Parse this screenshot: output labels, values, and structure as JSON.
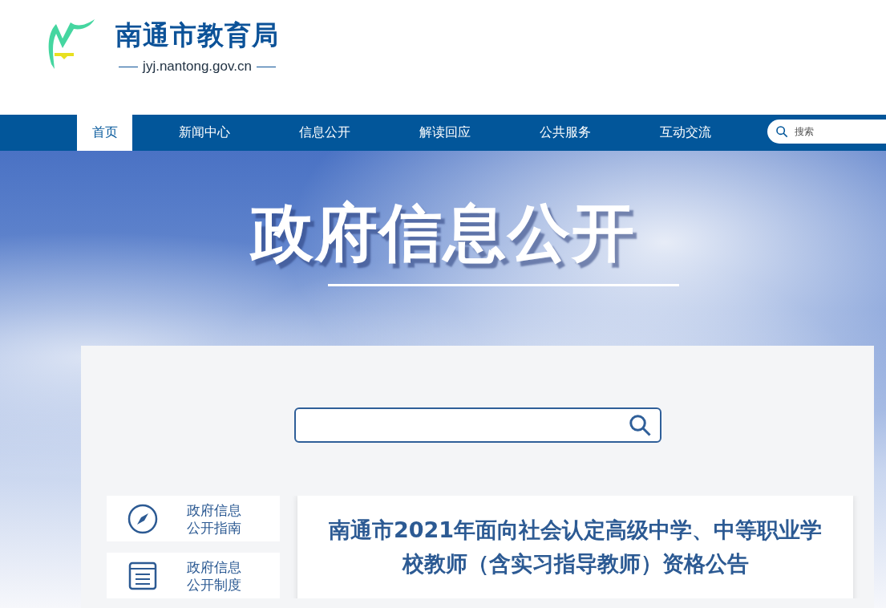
{
  "site": {
    "name": "南通市教育局",
    "domain": "jyj.nantong.gov.cn"
  },
  "nav": {
    "items": [
      {
        "label": "首页",
        "selected": true
      },
      {
        "label": "新闻中心",
        "selected": false
      },
      {
        "label": "信息公开",
        "selected": false
      },
      {
        "label": "解读回应",
        "selected": false
      },
      {
        "label": "公共服务",
        "selected": false
      },
      {
        "label": "互动交流",
        "selected": false
      }
    ],
    "search": {
      "placeholder": "搜索"
    }
  },
  "banner": {
    "title": "政府信息公开"
  },
  "sidebar": {
    "items": [
      {
        "kind": "compass",
        "lines": [
          "政府信息",
          "公开指南"
        ]
      },
      {
        "kind": "document",
        "lines": [
          "政府信息",
          "公开制度"
        ]
      }
    ]
  },
  "article": {
    "title": "南通市2021年面向社会认定高级中学、中等职业学校教师（含实习指导教师）资格公告"
  }
}
